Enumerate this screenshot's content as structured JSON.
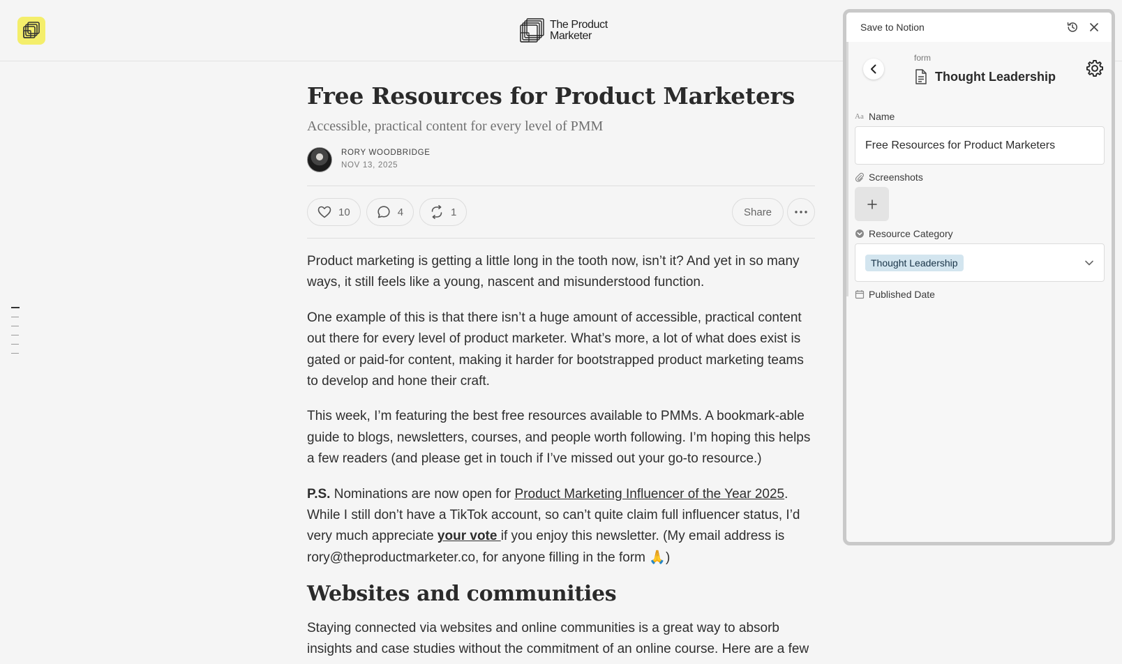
{
  "site": {
    "brand_line1": "The Product",
    "brand_line2": "Marketer"
  },
  "article": {
    "title": "Free Resources for Product Marketers",
    "subtitle": "Accessible, practical content for every level of PMM",
    "author": "RORY WOODBRIDGE",
    "date": "NOV 13, 2025",
    "likes": "10",
    "comments": "4",
    "restacks": "1",
    "share_label": "Share",
    "p1": "Product marketing is getting a little long in the tooth now, isn’t it? And yet in so many ways, it still feels like a young, nascent and misunderstood function.",
    "p2": "One example of this is that there isn’t a huge amount of accessible, practical content out there for every level of product marketer. What’s more, a lot of what does exist is gated or paid-for content, making it harder for bootstrapped product marketing teams to develop and hone their craft.",
    "p3": "This week, I’m featuring the best free resources available to PMMs. A bookmark-able guide to blogs, newsletters, courses, and people worth following. I’m hoping this helps a few readers (and please get in touch if I’ve missed out your go-to resource.)",
    "p4_bold": "P.S.",
    "p4_a": " Nominations are now open for ",
    "p4_link": "Product Marketing Influencer of the Year 2025",
    "p4_b": ". While I still don’t have a TikTok account, so can’t quite claim full influencer status, I’d very much appreciate ",
    "p4_vote": "your vote ",
    "p4_c": "if you enjoy this newsletter. (My email address is rory@theproductmarketer.co, for anyone filling in the form 🙏)",
    "h2": "Websites and communities",
    "p5": "Staying connected via websites and online communities is a great way to absorb insights and case studies without the commitment of an online course. Here are a few"
  },
  "notion": {
    "header_title": "Save to Notion",
    "form_label": "form",
    "database_title": "Thought Leadership",
    "fields": {
      "name_label": "Name",
      "name_value": "Free Resources for Product Marketers",
      "screenshots_label": "Screenshots",
      "category_label": "Resource Category",
      "category_value": "Thought Leadership",
      "published_label": "Published Date"
    }
  },
  "colors": {
    "logo_bg": "#f4ee6b",
    "tag_bg": "#d3e5ef",
    "page_bg": "#f5f5f5"
  }
}
